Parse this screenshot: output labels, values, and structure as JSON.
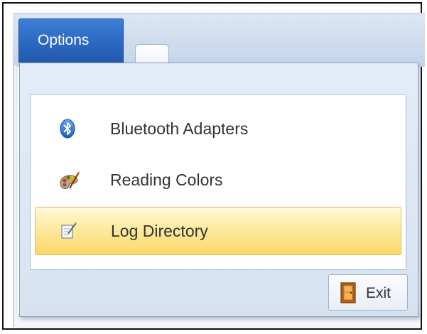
{
  "ribbon": {
    "options_tab_label": "Options"
  },
  "menu": {
    "items": [
      {
        "label": "Bluetooth Adapters",
        "icon": "bluetooth-icon"
      },
      {
        "label": "Reading Colors",
        "icon": "palette-icon"
      },
      {
        "label": "Log Directory",
        "icon": "log-file-icon",
        "highlighted": true
      }
    ],
    "exit_label": "Exit",
    "exit_icon": "exit-door-icon"
  },
  "colors": {
    "tab_blue": "#2b68c2",
    "highlight": "#fde89a",
    "panel": "#dce6f3"
  }
}
